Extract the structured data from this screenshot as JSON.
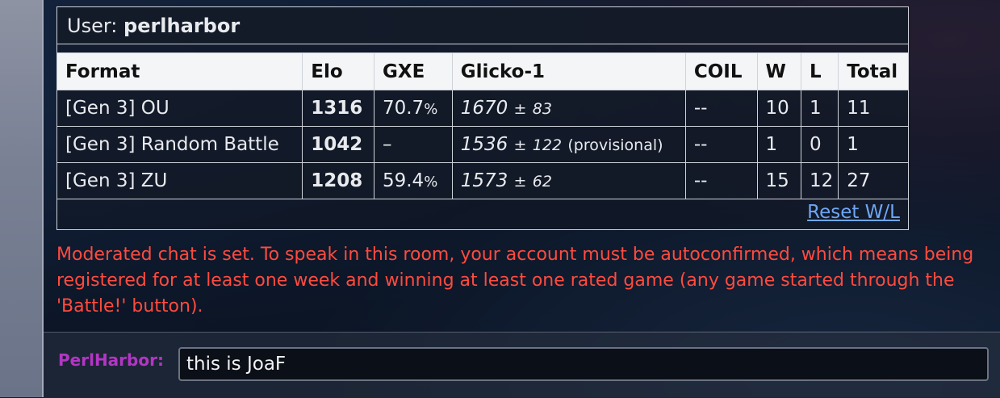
{
  "user": {
    "prefix": "User:",
    "name": "perlharbor"
  },
  "table": {
    "headers": [
      "Format",
      "Elo",
      "GXE",
      "Glicko-1",
      "COIL",
      "W",
      "L",
      "Total"
    ],
    "rows": [
      {
        "format": "[Gen 3] OU",
        "elo": "1316",
        "gxe": "70.7",
        "gxe_unit": "%",
        "glicko": "1670",
        "glicko_pm": "±",
        "glicko_dev": "83",
        "provisional": "",
        "coil": "--",
        "w": "10",
        "l": "1",
        "total": "11"
      },
      {
        "format": "[Gen 3] Random Battle",
        "elo": "1042",
        "gxe": "–",
        "gxe_unit": "",
        "glicko": "1536",
        "glicko_pm": "±",
        "glicko_dev": "122",
        "provisional": "(provisional)",
        "coil": "--",
        "w": "1",
        "l": "0",
        "total": "1"
      },
      {
        "format": "[Gen 3] ZU",
        "elo": "1208",
        "gxe": "59.4",
        "gxe_unit": "%",
        "glicko": "1573",
        "glicko_pm": "±",
        "glicko_dev": "62",
        "provisional": "",
        "coil": "--",
        "w": "15",
        "l": "12",
        "total": "27"
      }
    ],
    "reset_label": "Reset W/L"
  },
  "moderation_message": "Moderated chat is set. To speak in this room, your account must be autoconfirmed, which means being registered for at least one week and winning at least one rated game (any game started through the 'Battle!' button).",
  "chat": {
    "username_label": "PerlHarbor:",
    "input_value": "this is JoaF"
  },
  "colors": {
    "moderation_text": "#ff4b3e",
    "username": "#b236c4",
    "link": "#6ea6f5"
  }
}
